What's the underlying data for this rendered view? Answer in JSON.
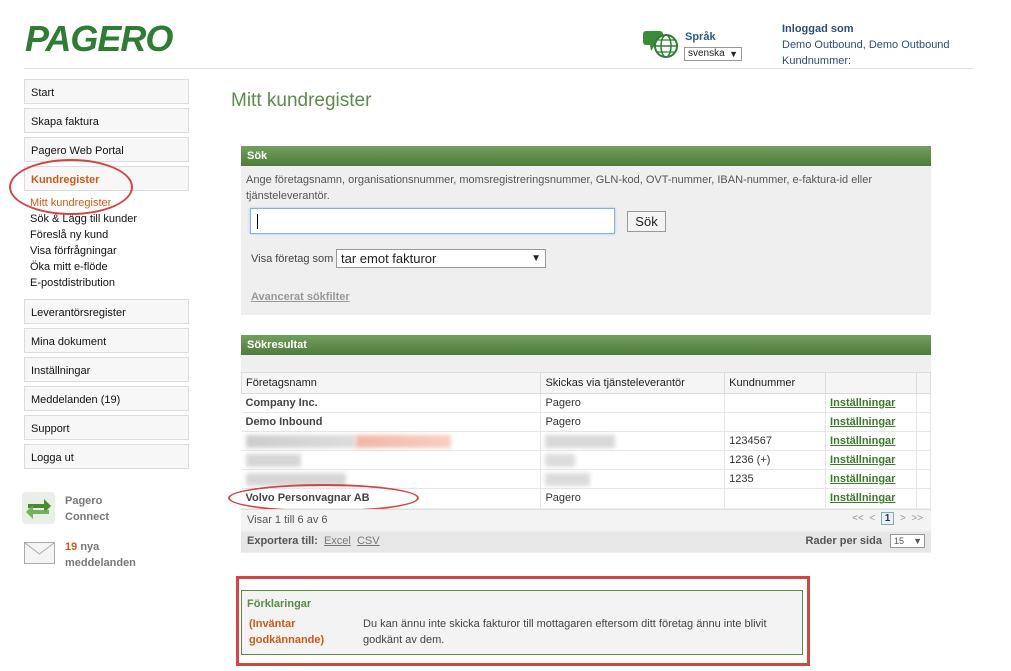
{
  "header": {
    "logo": "PAGERO",
    "language_label": "Språk",
    "language_value": "svenska",
    "logged_in_label": "Inloggad som",
    "user_name": "Demo Outbound, Demo Outbound",
    "customer_number_label": "Kundnummer:"
  },
  "sidebar": {
    "items": [
      {
        "label": "Start"
      },
      {
        "label": "Skapa faktura"
      },
      {
        "label": "Pagero Web Portal"
      },
      {
        "label": "Kundregister"
      },
      {
        "label": "Leverantörsregister"
      },
      {
        "label": "Mina dokument"
      },
      {
        "label": "Inställningar"
      },
      {
        "label": "Meddelanden (19)"
      },
      {
        "label": "Support"
      },
      {
        "label": "Logga ut"
      }
    ],
    "sub_items": [
      {
        "label": "Mitt kundregister"
      },
      {
        "label": "Sök & Lägg till kunder"
      },
      {
        "label": "Föreslå ny kund"
      },
      {
        "label": "Visa förfrågningar"
      },
      {
        "label": "Öka mitt e-flöde"
      },
      {
        "label": "E-postdistribution"
      }
    ],
    "connect_line1": "Pagero",
    "connect_line2": "Connect",
    "messages_count": "19",
    "messages_word": "nya",
    "messages_line2": "meddelanden"
  },
  "main": {
    "page_title": "Mitt kundregister",
    "search": {
      "header": "Sök",
      "description": "Ange företagsnamn, organisationsnummer, momsregistreringsnummer, GLN-kod, OVT-nummer, IBAN-nummer, e-faktura-id eller tjänsteleverantör.",
      "input_value": "",
      "button_label": "Sök",
      "show_label": "Visa företag som",
      "show_value": "tar emot fakturor",
      "advanced_link": "Avancerat sökfilter"
    },
    "results": {
      "header": "Sökresultat",
      "columns": [
        "Företagsnamn",
        "Skickas via tjänsteleverantör",
        "Kundnummer",
        ""
      ],
      "rows": [
        {
          "name": "Company Inc.",
          "provider": "Pagero",
          "number": "",
          "action": "Inställningar"
        },
        {
          "name": "Demo Inbound",
          "provider": "Pagero",
          "number": "",
          "action": "Inställningar"
        },
        {
          "name": "",
          "provider": "",
          "number": "1234567",
          "action": "Inställningar"
        },
        {
          "name": "",
          "provider": "",
          "number": "1236 (+)",
          "action": "Inställningar"
        },
        {
          "name": "",
          "provider": "",
          "number": "1235",
          "action": "Inställningar"
        },
        {
          "name": "Volvo Personvagnar AB",
          "provider": "Pagero",
          "number": "",
          "action": "Inställningar"
        }
      ],
      "showing": "Visar 1 till 6 av 6",
      "pager_first": "<<",
      "pager_prev": "<",
      "pager_current": "1",
      "pager_next": ">",
      "pager_last": ">>",
      "export_label": "Exportera till:",
      "export_excel": "Excel",
      "export_csv": "CSV",
      "rows_per_page_label": "Rader per sida",
      "rows_per_page_value": "15"
    },
    "legend": {
      "title": "Förklaringar",
      "term": "(Inväntar godkännande)",
      "description": "Du kan ännu inte skicka fakturor till mottagaren eftersom ditt företag ännu inte blivit godkänt av dem."
    }
  },
  "colors": {
    "brand_green": "#2e7d32",
    "panel_green": "#5b8a48",
    "accent_orange": "#cc5a1a",
    "annotation_red": "#d24545"
  }
}
